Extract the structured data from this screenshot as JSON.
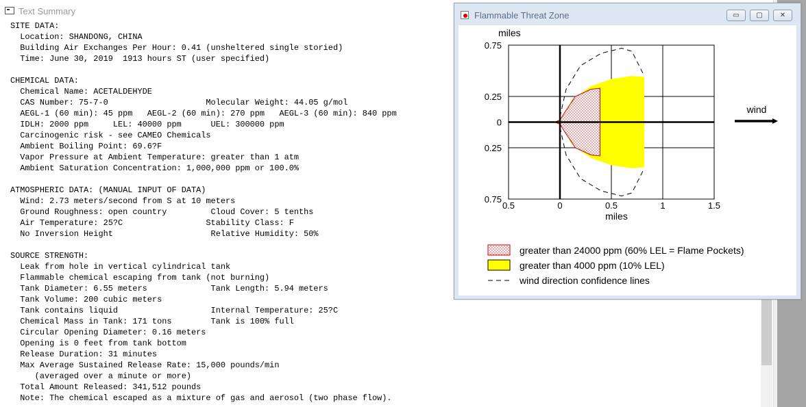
{
  "text_summary": {
    "title": "Text Summary",
    "lines": [
      "SITE DATA:",
      "  Location: SHANDONG, CHINA",
      "  Building Air Exchanges Per Hour: 0.41 (unsheltered single storied)",
      "  Time: June 30, 2019  1913 hours ST (user specified)",
      "",
      "CHEMICAL DATA:",
      "  Chemical Name: ACETALDEHYDE",
      "  CAS Number: 75-7-0                    Molecular Weight: 44.05 g/mol",
      "  AEGL-1 (60 min): 45 ppm   AEGL-2 (60 min): 270 ppm   AEGL-3 (60 min): 840 ppm",
      "  IDLH: 2000 ppm     LEL: 40000 ppm      UEL: 300000 ppm",
      "  Carcinogenic risk - see CAMEO Chemicals",
      "  Ambient Boiling Point: 69.6?F",
      "  Vapor Pressure at Ambient Temperature: greater than 1 atm",
      "  Ambient Saturation Concentration: 1,000,000 ppm or 100.0%",
      "",
      "ATMOSPHERIC DATA: (MANUAL INPUT OF DATA)",
      "  Wind: 2.73 meters/second from S at 10 meters",
      "  Ground Roughness: open country         Cloud Cover: 5 tenths",
      "  Air Temperature: 25?C                 Stability Class: F",
      "  No Inversion Height                    Relative Humidity: 50%",
      "",
      "SOURCE STRENGTH:",
      "  Leak from hole in vertical cylindrical tank",
      "  Flammable chemical escaping from tank (not burning)",
      "  Tank Diameter: 6.55 meters             Tank Length: 5.94 meters",
      "  Tank Volume: 200 cubic meters",
      "  Tank contains liquid                   Internal Temperature: 25?C",
      "  Chemical Mass in Tank: 171 tons        Tank is 100% full",
      "  Circular Opening Diameter: 0.16 meters",
      "  Opening is 0 feet from tank bottom",
      "  Release Duration: 31 minutes",
      "  Max Average Sustained Release Rate: 15,000 pounds/min",
      "     (averaged over a minute or more)",
      "  Total Amount Released: 341,512 pounds",
      "  Note: The chemical escaped as a mixture of gas and aerosol (two phase flow)."
    ]
  },
  "threat_zone_window": {
    "title": "Flammable Threat Zone",
    "buttons": {
      "minimize": "▭",
      "maximize": "▢",
      "close": "✕"
    }
  },
  "chart_data": {
    "type": "area",
    "xlabel": "miles",
    "ylabel": "miles",
    "xlim": [
      -0.5,
      1.5
    ],
    "ylim": [
      -0.75,
      0.75
    ],
    "x_ticks": [
      "0.5",
      "0",
      "0.5",
      "1",
      "1.5"
    ],
    "x_tick_values": [
      -0.5,
      0,
      0.5,
      1,
      1.5
    ],
    "y_ticks": [
      "0.75",
      "0.25",
      "0",
      "0.25",
      "0.75"
    ],
    "y_tick_values": [
      0.75,
      0.25,
      0,
      -0.25,
      -0.75
    ],
    "grid": true,
    "wind_label": "wind",
    "zones": [
      {
        "name": "greater than 4000 ppm (10% LEL)",
        "color": "#ffff00",
        "outline": [
          [
            0,
            0.02
          ],
          [
            0.12,
            0.22
          ],
          [
            0.3,
            0.35
          ],
          [
            0.5,
            0.42
          ],
          [
            0.7,
            0.45
          ],
          [
            0.82,
            0.44
          ],
          [
            0.82,
            -0.44
          ],
          [
            0.7,
            -0.45
          ],
          [
            0.5,
            -0.42
          ],
          [
            0.3,
            -0.35
          ],
          [
            0.12,
            -0.22
          ],
          [
            0,
            -0.02
          ]
        ]
      },
      {
        "name": "greater than 24000 ppm (60% LEL = Flame Pockets)",
        "color": "#ff9999",
        "outline": [
          [
            0,
            0.02
          ],
          [
            0.05,
            0.1
          ],
          [
            0.15,
            0.25
          ],
          [
            0.3,
            0.32
          ],
          [
            0.39,
            0.33
          ],
          [
            0.39,
            -0.33
          ],
          [
            0.3,
            -0.32
          ],
          [
            0.15,
            -0.25
          ],
          [
            0.05,
            -0.1
          ],
          [
            0,
            -0.02
          ],
          [
            -0.05,
            0
          ]
        ]
      }
    ],
    "confidence_lines": {
      "name": "wind direction confidence lines",
      "upper": [
        [
          0,
          0.05
        ],
        [
          0.06,
          0.32
        ],
        [
          0.2,
          0.55
        ],
        [
          0.4,
          0.67
        ],
        [
          0.6,
          0.72
        ],
        [
          0.7,
          0.69
        ],
        [
          0.82,
          0.45
        ]
      ],
      "lower": [
        [
          0,
          -0.05
        ],
        [
          0.06,
          -0.32
        ],
        [
          0.2,
          -0.55
        ],
        [
          0.4,
          -0.67
        ],
        [
          0.6,
          -0.72
        ],
        [
          0.7,
          -0.69
        ],
        [
          0.82,
          -0.45
        ]
      ]
    },
    "legend": [
      {
        "label": "greater than 24000 ppm (60% LEL = Flame Pockets)",
        "style": "dotted-red"
      },
      {
        "label": "greater than 4000 ppm (10% LEL)",
        "style": "yellow"
      },
      {
        "label": "wind direction confidence lines",
        "style": "dashed"
      }
    ]
  }
}
